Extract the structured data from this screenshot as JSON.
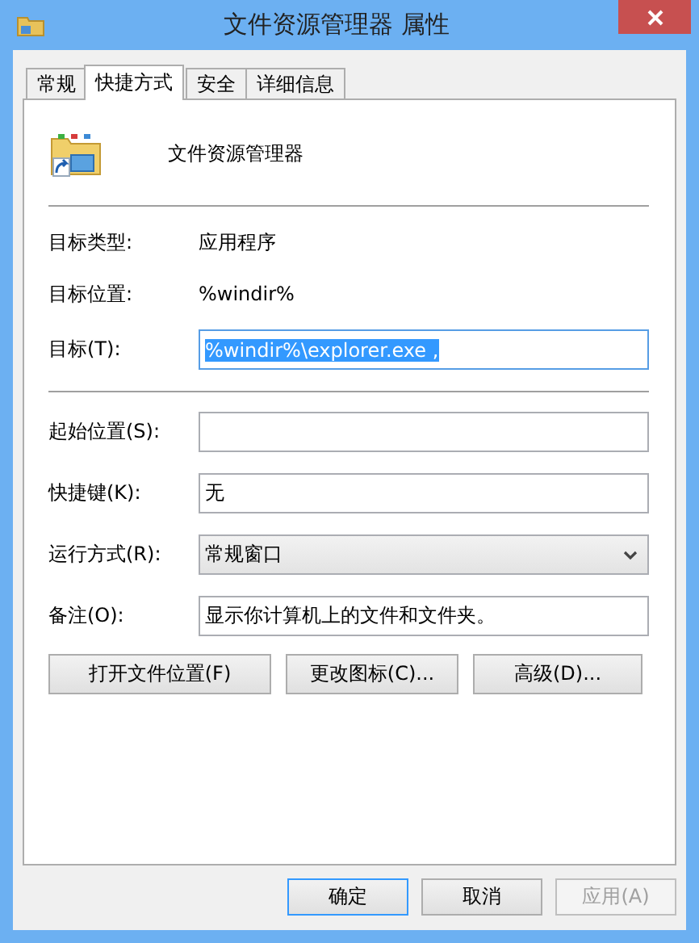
{
  "window": {
    "title": "文件资源管理器 属性"
  },
  "tabs": [
    {
      "label": "常规",
      "selected": false
    },
    {
      "label": "快捷方式",
      "selected": true
    },
    {
      "label": "安全",
      "selected": false
    },
    {
      "label": "详细信息",
      "selected": false
    }
  ],
  "app_name": "文件资源管理器",
  "info": [
    {
      "label": "目标类型:",
      "value": "应用程序"
    },
    {
      "label": "目标位置:",
      "value": "%windir%"
    }
  ],
  "target": {
    "label": "目标(T):",
    "value": "%windir%\\explorer.exe ,",
    "selected": true
  },
  "fields": [
    {
      "kind": "text",
      "label": "起始位置(S):"
    },
    {
      "kind": "text",
      "label": "快捷键(K):",
      "value": "无"
    },
    {
      "kind": "dropdown",
      "label": "运行方式(R):",
      "value": "常规窗口"
    },
    {
      "kind": "text",
      "label": "备注(O):",
      "value": "显示你计算机上的文件和文件夹。"
    }
  ],
  "action_buttons": [
    "打开文件位置(F)",
    "更改图标(C)...",
    "高级(D)..."
  ],
  "dialog_buttons": [
    {
      "label": "确定",
      "default": true,
      "disabled": false
    },
    {
      "label": "取消",
      "default": false,
      "disabled": false
    },
    {
      "label": "应用(A)",
      "default": false,
      "disabled": true
    }
  ]
}
